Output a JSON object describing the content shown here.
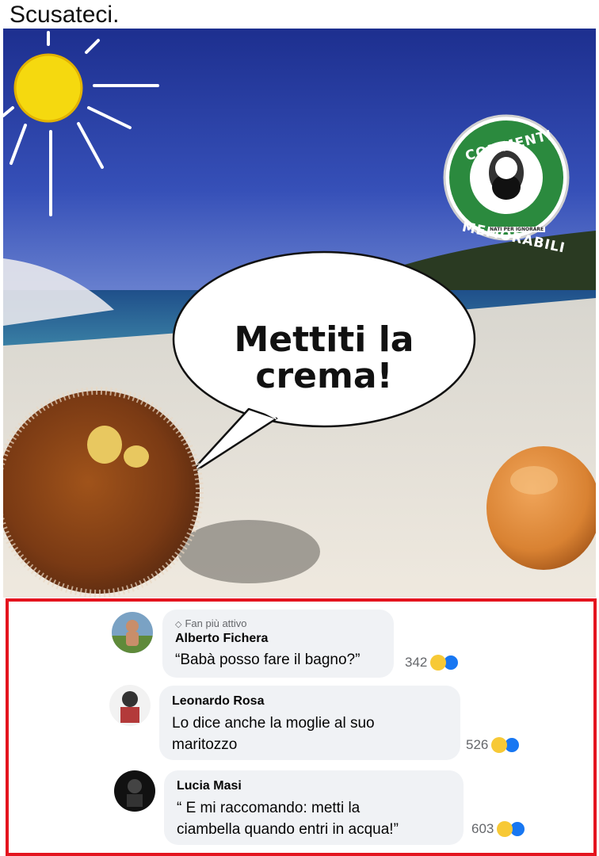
{
  "post": {
    "caption": "Scusateci.",
    "image": {
      "speech_bubble_text": "Mettiti la crema!",
      "logo": {
        "top_text": "COMMENTI",
        "bottom_text": "MEMORABILI",
        "sub_text": "NATI PER IGNORARE"
      }
    }
  },
  "comments": [
    {
      "badge": "Fan più attivo",
      "author": "Alberto Fichera",
      "text": "“Babà posso fare il bagno?”",
      "reaction_count": "342"
    },
    {
      "author": "Leonardo Rosa",
      "text_line1": "Lo dice anche la moglie al suo",
      "text_line2": "maritozzo",
      "reaction_count": "526"
    },
    {
      "author": "Lucia Masi",
      "text_line1": "“ E mi raccomando: metti la",
      "text_line2": "ciambella quando entri in acqua!”",
      "reaction_count": "603"
    }
  ],
  "colors": {
    "highlight_border": "#e4141e",
    "bubble_bg": "#f0f2f5",
    "like_blue": "#1877f2",
    "haha_yellow": "#f7c936"
  }
}
